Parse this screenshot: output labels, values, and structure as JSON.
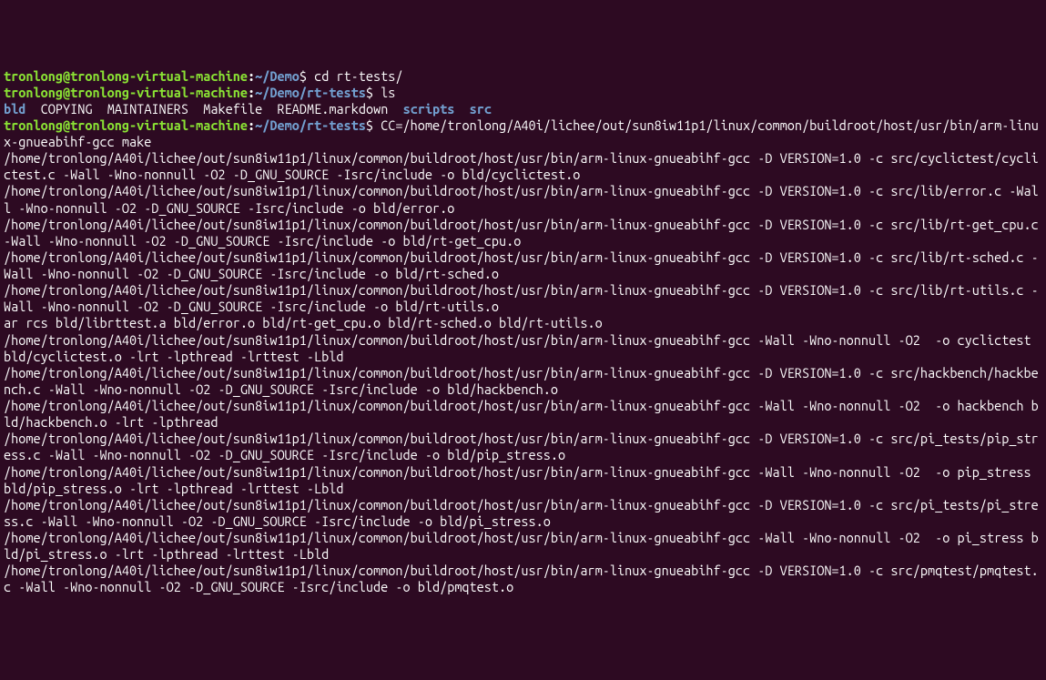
{
  "prompt1": {
    "user": "tronlong@tronlong-virtual-machine",
    "colon": ":",
    "path": "~/Demo",
    "dollar": "$ ",
    "cmd": "cd rt-tests/"
  },
  "prompt2": {
    "user": "tronlong@tronlong-virtual-machine",
    "colon": ":",
    "path": "~/Demo/rt-tests",
    "dollar": "$ ",
    "cmd": "ls"
  },
  "ls": {
    "bld": "bld",
    "sep1": "  ",
    "copying": "COPYING",
    "sep2": "  ",
    "maintainers": "MAINTAINERS",
    "sep3": "  ",
    "makefile": "Makefile",
    "sep4": "  ",
    "readme": "README.markdown",
    "sep5": "  ",
    "scripts": "scripts",
    "sep6": "  ",
    "src": "src"
  },
  "prompt3": {
    "user": "tronlong@tronlong-virtual-machine",
    "colon": ":",
    "path": "~/Demo/rt-tests",
    "dollar": "$ ",
    "cmd": "CC=/home/tronlong/A40i/lichee/out/sun8iw11p1/linux/common/buildroot/host/usr/bin/arm-linux-gnueabihf-gcc make"
  },
  "out": {
    "l1": "/home/tronlong/A40i/lichee/out/sun8iw11p1/linux/common/buildroot/host/usr/bin/arm-linux-gnueabihf-gcc -D VERSION=1.0 -c src/cyclictest/cyclictest.c -Wall -Wno-nonnull -O2 -D_GNU_SOURCE -Isrc/include -o bld/cyclictest.o",
    "l2": "/home/tronlong/A40i/lichee/out/sun8iw11p1/linux/common/buildroot/host/usr/bin/arm-linux-gnueabihf-gcc -D VERSION=1.0 -c src/lib/error.c -Wall -Wno-nonnull -O2 -D_GNU_SOURCE -Isrc/include -o bld/error.o",
    "l3": "/home/tronlong/A40i/lichee/out/sun8iw11p1/linux/common/buildroot/host/usr/bin/arm-linux-gnueabihf-gcc -D VERSION=1.0 -c src/lib/rt-get_cpu.c -Wall -Wno-nonnull -O2 -D_GNU_SOURCE -Isrc/include -o bld/rt-get_cpu.o",
    "l4": "/home/tronlong/A40i/lichee/out/sun8iw11p1/linux/common/buildroot/host/usr/bin/arm-linux-gnueabihf-gcc -D VERSION=1.0 -c src/lib/rt-sched.c -Wall -Wno-nonnull -O2 -D_GNU_SOURCE -Isrc/include -o bld/rt-sched.o",
    "l5": "/home/tronlong/A40i/lichee/out/sun8iw11p1/linux/common/buildroot/host/usr/bin/arm-linux-gnueabihf-gcc -D VERSION=1.0 -c src/lib/rt-utils.c -Wall -Wno-nonnull -O2 -D_GNU_SOURCE -Isrc/include -o bld/rt-utils.o",
    "l6": "ar rcs bld/librttest.a bld/error.o bld/rt-get_cpu.o bld/rt-sched.o bld/rt-utils.o",
    "l7": "/home/tronlong/A40i/lichee/out/sun8iw11p1/linux/common/buildroot/host/usr/bin/arm-linux-gnueabihf-gcc -Wall -Wno-nonnull -O2  -o cyclictest bld/cyclictest.o -lrt -lpthread -lrttest -Lbld",
    "l8": "/home/tronlong/A40i/lichee/out/sun8iw11p1/linux/common/buildroot/host/usr/bin/arm-linux-gnueabihf-gcc -D VERSION=1.0 -c src/hackbench/hackbench.c -Wall -Wno-nonnull -O2 -D_GNU_SOURCE -Isrc/include -o bld/hackbench.o",
    "l9": "/home/tronlong/A40i/lichee/out/sun8iw11p1/linux/common/buildroot/host/usr/bin/arm-linux-gnueabihf-gcc -Wall -Wno-nonnull -O2  -o hackbench bld/hackbench.o -lrt -lpthread",
    "l10": "/home/tronlong/A40i/lichee/out/sun8iw11p1/linux/common/buildroot/host/usr/bin/arm-linux-gnueabihf-gcc -D VERSION=1.0 -c src/pi_tests/pip_stress.c -Wall -Wno-nonnull -O2 -D_GNU_SOURCE -Isrc/include -o bld/pip_stress.o",
    "l11": "/home/tronlong/A40i/lichee/out/sun8iw11p1/linux/common/buildroot/host/usr/bin/arm-linux-gnueabihf-gcc -Wall -Wno-nonnull -O2  -o pip_stress bld/pip_stress.o -lrt -lpthread -lrttest -Lbld",
    "l12": "/home/tronlong/A40i/lichee/out/sun8iw11p1/linux/common/buildroot/host/usr/bin/arm-linux-gnueabihf-gcc -D VERSION=1.0 -c src/pi_tests/pi_stress.c -Wall -Wno-nonnull -O2 -D_GNU_SOURCE -Isrc/include -o bld/pi_stress.o",
    "l13": "/home/tronlong/A40i/lichee/out/sun8iw11p1/linux/common/buildroot/host/usr/bin/arm-linux-gnueabihf-gcc -Wall -Wno-nonnull -O2  -o pi_stress bld/pi_stress.o -lrt -lpthread -lrttest -Lbld",
    "l14": "/home/tronlong/A40i/lichee/out/sun8iw11p1/linux/common/buildroot/host/usr/bin/arm-linux-gnueabihf-gcc -D VERSION=1.0 -c src/pmqtest/pmqtest.c -Wall -Wno-nonnull -O2 -D_GNU_SOURCE -Isrc/include -o bld/pmqtest.o"
  }
}
